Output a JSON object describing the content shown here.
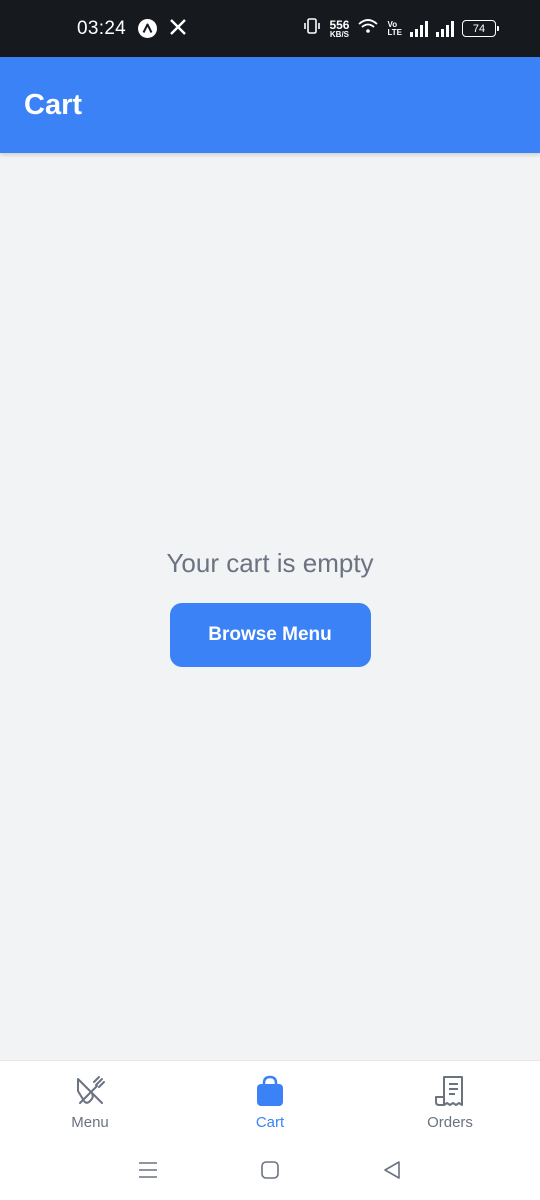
{
  "status_bar": {
    "time": "03:24",
    "net_speed_value": "556",
    "net_speed_unit": "KB/S",
    "volte_top": "Vo",
    "volte_bottom": "LTE",
    "battery": "74",
    "icons": [
      "a-app-icon",
      "x-logo-icon",
      "vibrate-icon",
      "wifi-icon",
      "signal-icon",
      "signal-icon",
      "battery-icon"
    ]
  },
  "app_bar": {
    "title": "Cart"
  },
  "empty_state": {
    "message": "Your cart is empty",
    "button_label": "Browse Menu"
  },
  "bottom_nav": {
    "items": [
      {
        "label": "Menu",
        "icon": "fork-knife-icon",
        "active": false
      },
      {
        "label": "Cart",
        "icon": "shopping-bag-icon",
        "active": true
      },
      {
        "label": "Orders",
        "icon": "receipt-icon",
        "active": false
      }
    ]
  },
  "system_nav": {
    "icons": [
      "recents-icon",
      "home-icon",
      "back-icon"
    ]
  },
  "colors": {
    "primary": "#3b82f6",
    "background": "#f2f3f5",
    "muted_text": "#6b7280",
    "status_bar": "#16191d"
  }
}
